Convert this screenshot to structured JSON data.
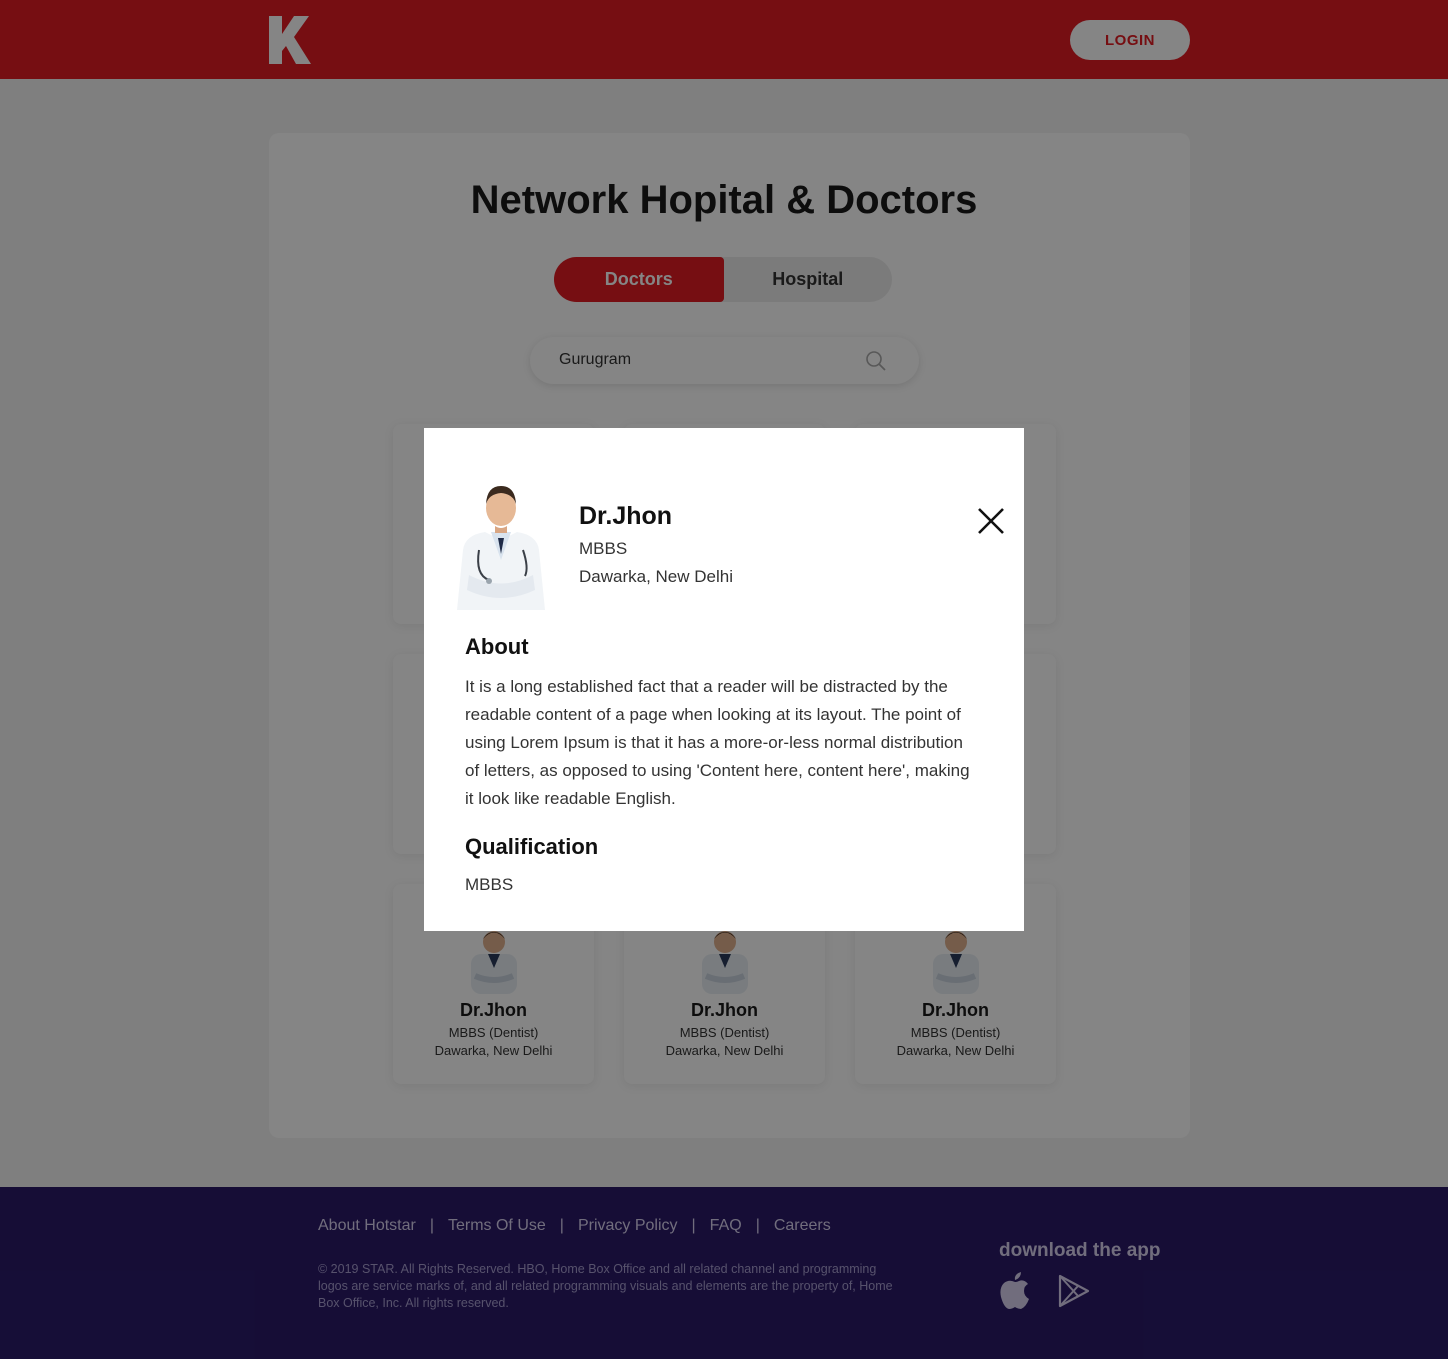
{
  "header": {
    "logo_letter": "K",
    "login_label": "LOGIN",
    "brand_color": "#e21b23"
  },
  "main": {
    "title": "Network Hopital & Doctors",
    "tabs": [
      {
        "label": "Doctors",
        "active": true
      },
      {
        "label": "Hospital",
        "active": false
      }
    ],
    "search": {
      "value": "Gurugram",
      "icon": "search-icon"
    }
  },
  "cards": [
    {
      "name": "Dr.Jhon",
      "degree": "MBBS (Dentist)",
      "location": "Dawarka, New Delhi"
    },
    {
      "name": "Dr.Jhon",
      "degree": "MBBS (Dentist)",
      "location": "Dawarka, New Delhi"
    },
    {
      "name": "Dr.Jhon",
      "degree": "MBBS (Dentist)",
      "location": "Dawarka, New Delhi"
    }
  ],
  "modal": {
    "name": "Dr.Jhon",
    "degree": "MBBS",
    "location": "Dawarka, New Delhi",
    "about_heading": "About",
    "about_text": "It is a long established fact that a reader will be distracted by the readable content of a page when looking at its layout. The point of using Lorem Ipsum is that it has a more-or-less normal distribution of letters, as opposed to using 'Content here, content here', making it look like readable English.",
    "qualification_heading": "Qualification",
    "qualification_text": "MBBS",
    "close_icon": "close-icon"
  },
  "footer": {
    "links": [
      "About Hotstar",
      "Terms Of Use",
      "Privacy Policy",
      "FAQ",
      "Careers"
    ],
    "separator": "|",
    "copyright": "© 2019 STAR. All Rights Reserved. HBO, Home Box Office and all related channel and programming logos are service marks of, and all related programming visuals and elements are the property of, Home Box Office, Inc. All rights reserved.",
    "download_title": "download the app",
    "store_icons": [
      "apple-icon",
      "play-store-icon"
    ]
  }
}
